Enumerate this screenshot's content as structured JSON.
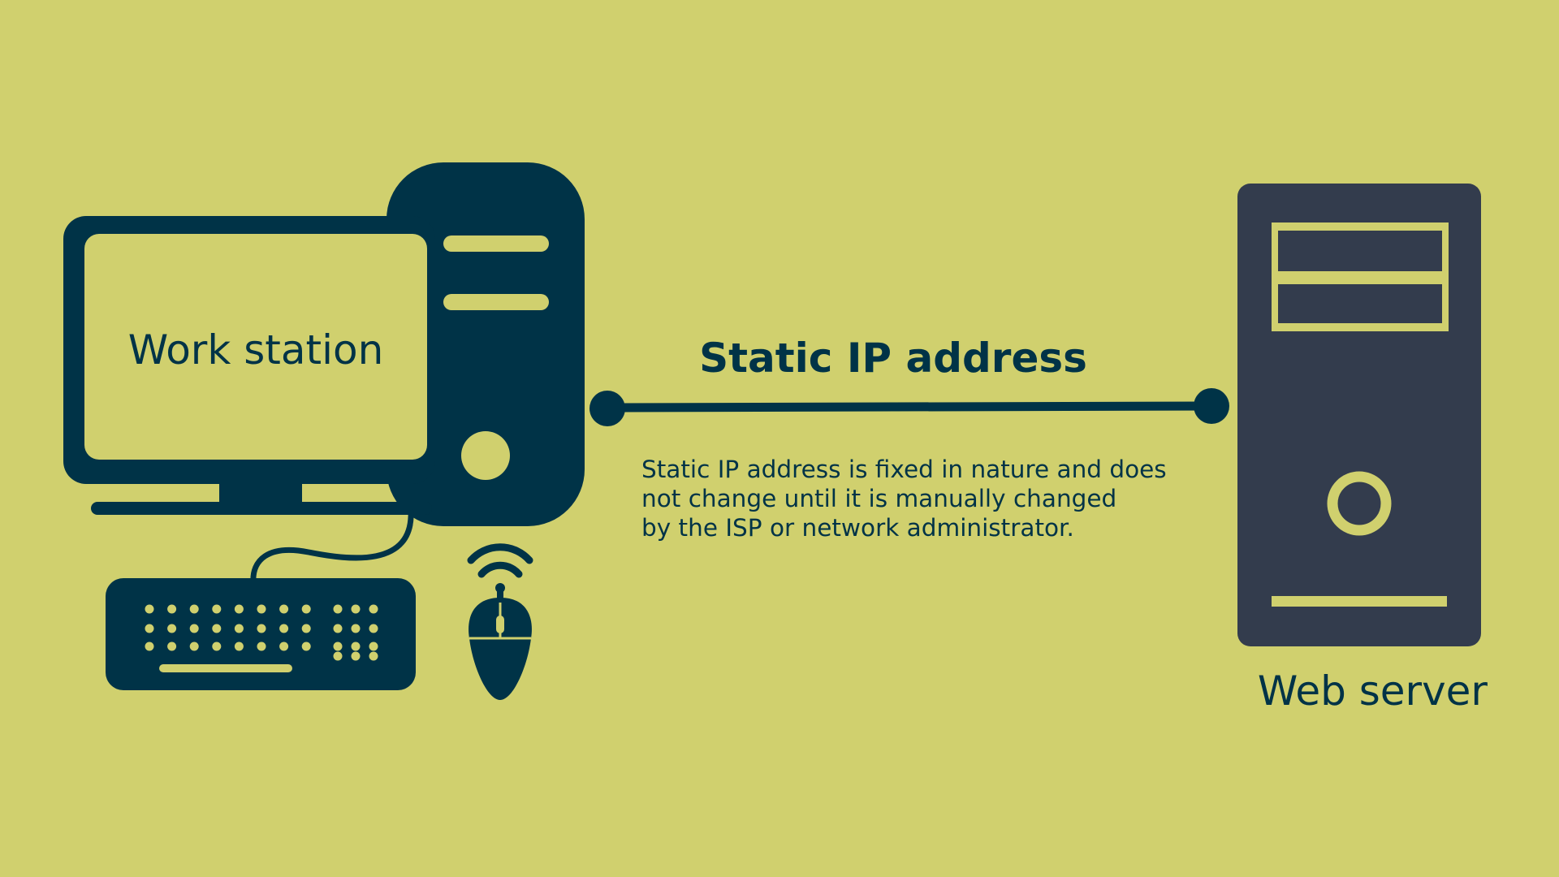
{
  "colors": {
    "background": "#d0d06e",
    "dark_navy": "#003347",
    "server_slate": "#333c4d",
    "accent_yellow": "#d0d06e"
  },
  "workstation": {
    "label": "Work station",
    "icons": [
      "monitor-icon",
      "computer-tower-icon",
      "keyboard-icon",
      "wireless-mouse-icon"
    ]
  },
  "connection": {
    "title": "Static IP address",
    "description_lines": [
      "Static IP address is fixed in nature and does",
      "not change until it is manually changed",
      "by the ISP or network administrator."
    ]
  },
  "server": {
    "label": "Web server",
    "icon": "server-tower-icon"
  }
}
